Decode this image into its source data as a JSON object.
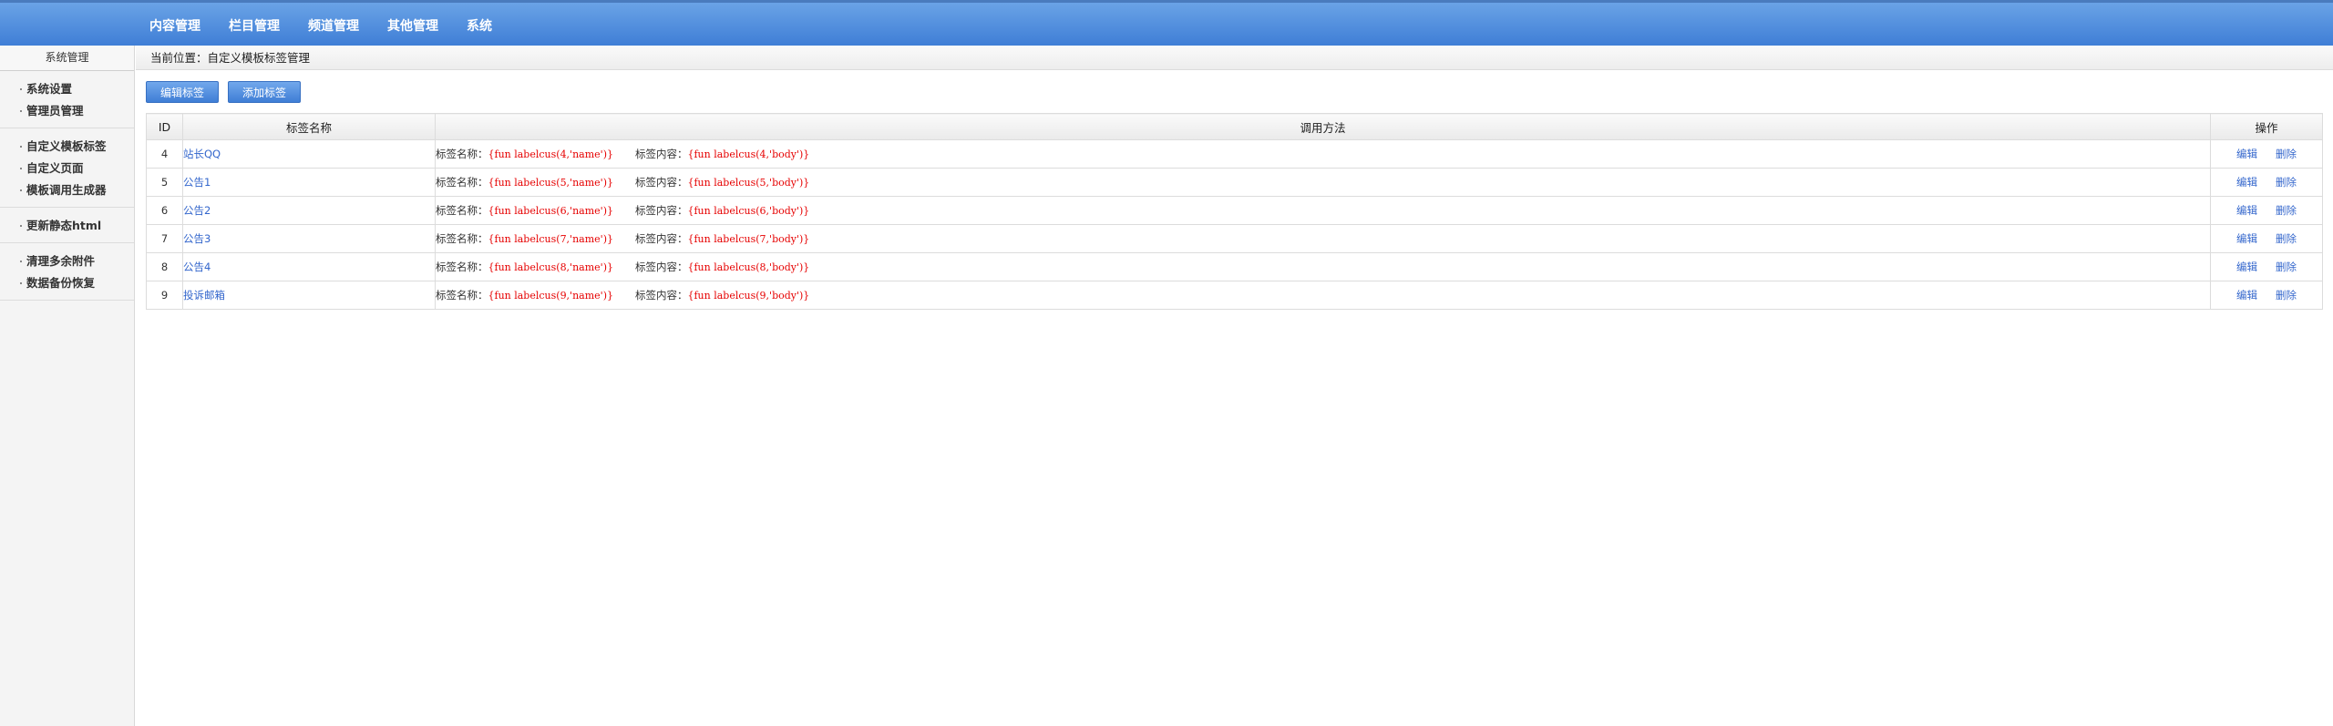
{
  "nav": [
    "内容管理",
    "栏目管理",
    "频道管理",
    "其他管理",
    "系统"
  ],
  "sidebar": {
    "title": "系统管理",
    "groups": [
      [
        "系统设置",
        "管理员管理"
      ],
      [
        "自定义模板标签",
        "自定义页面",
        "模板调用生成器"
      ],
      [
        "更新静态html"
      ],
      [
        "清理多余附件",
        "数据备份恢复"
      ]
    ]
  },
  "breadcrumb": "当前位置：自定义模板标签管理",
  "buttons": {
    "edit": "编辑标签",
    "add": "添加标签"
  },
  "table": {
    "headers": [
      "ID",
      "标签名称",
      "调用方法",
      "操作"
    ],
    "name_prefix": "标签名称：",
    "body_prefix": "标签内容：",
    "edit_label": "编辑",
    "delete_label": "删除",
    "rows": [
      {
        "id": "4",
        "name": "站长QQ",
        "name_code": "{fun labelcus(4,'name')}",
        "body_code": "{fun labelcus(4,'body')}"
      },
      {
        "id": "5",
        "name": "公告1",
        "name_code": "{fun labelcus(5,'name')}",
        "body_code": "{fun labelcus(5,'body')}"
      },
      {
        "id": "6",
        "name": "公告2",
        "name_code": "{fun labelcus(6,'name')}",
        "body_code": "{fun labelcus(6,'body')}"
      },
      {
        "id": "7",
        "name": "公告3",
        "name_code": "{fun labelcus(7,'name')}",
        "body_code": "{fun labelcus(7,'body')}"
      },
      {
        "id": "8",
        "name": "公告4",
        "name_code": "{fun labelcus(8,'name')}",
        "body_code": "{fun labelcus(8,'body')}"
      },
      {
        "id": "9",
        "name": "投诉邮箱",
        "name_code": "{fun labelcus(9,'name')}",
        "body_code": "{fun labelcus(9,'body')}"
      }
    ]
  },
  "colors": {
    "topbar": "#4f8fe0",
    "link": "#3366cc",
    "code": "#e60000"
  }
}
